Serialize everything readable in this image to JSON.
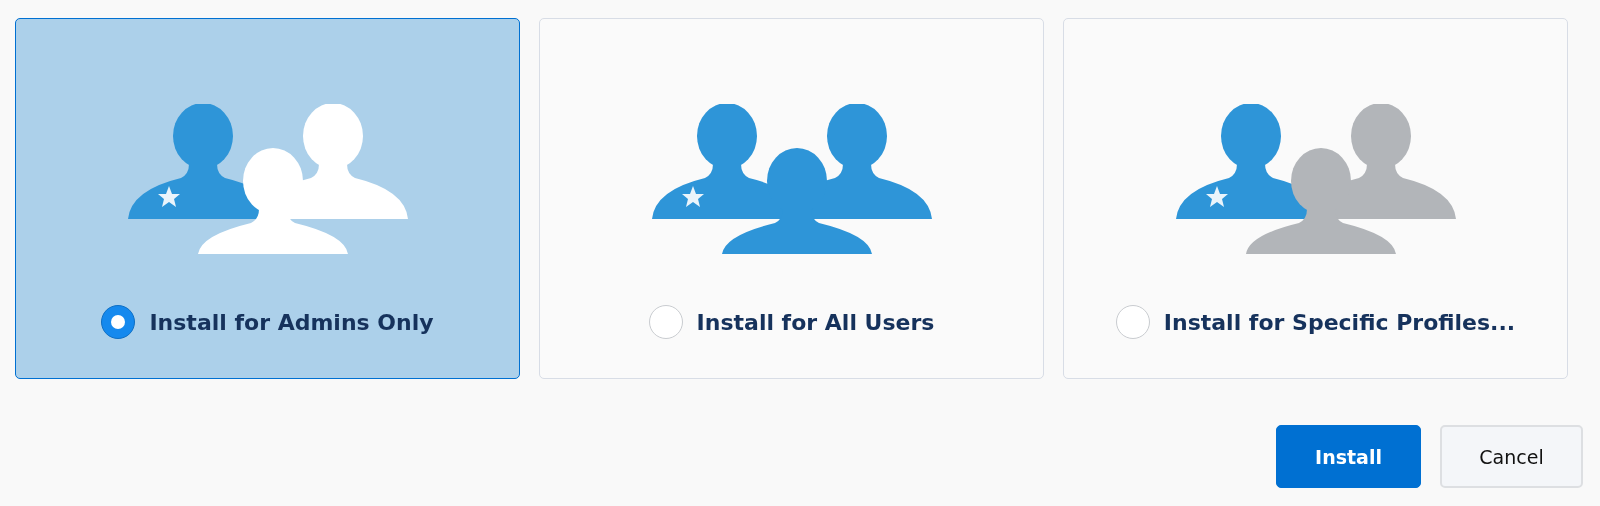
{
  "options": [
    {
      "kind": "admins",
      "label": "Install for Admins Only",
      "selected": true
    },
    {
      "kind": "all",
      "label": "Install for All Users",
      "selected": false
    },
    {
      "kind": "profiles",
      "label": "Install for Specific Profiles...",
      "selected": false
    }
  ],
  "buttons": [
    {
      "kind": "primary",
      "label": "Install"
    },
    {
      "kind": "secondary",
      "label": "Cancel"
    }
  ]
}
